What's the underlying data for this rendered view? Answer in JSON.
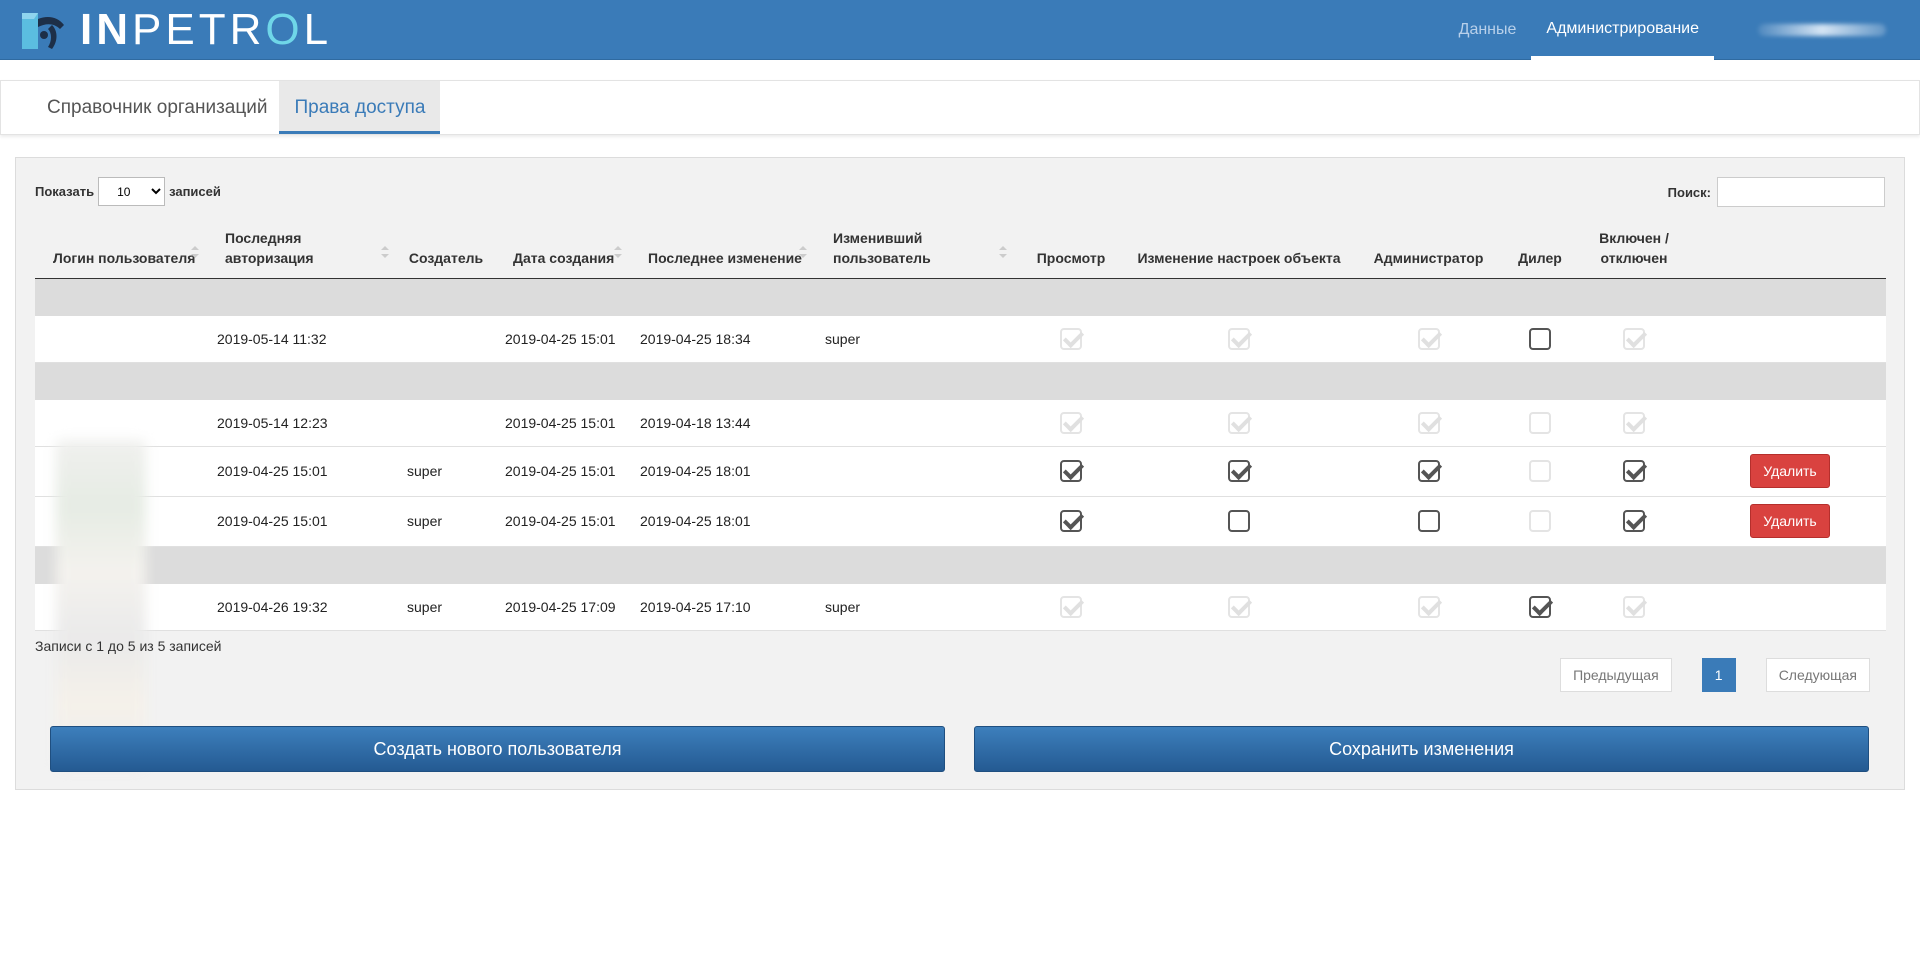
{
  "header": {
    "logo_text_bold": "IN",
    "logo_text_rest": "PETR",
    "logo_text_o": "O",
    "logo_text_end": "L",
    "nav": [
      {
        "label": "Данные"
      },
      {
        "label": "Администрирование"
      }
    ]
  },
  "tabs": [
    {
      "label": "Справочник организаций"
    },
    {
      "label": "Права доступа"
    }
  ],
  "controls": {
    "show_label": "Показать",
    "page_size": "10",
    "records_label": "записей",
    "search_label": "Поиск:",
    "search_value": ""
  },
  "columns": [
    "Логин пользователя",
    "Последняя авторизация",
    "Создатель",
    "Дата создания",
    "Последнее изменение",
    "Изменивший пользователь",
    "Просмотр",
    "Изменение настроек объекта",
    "Администратор",
    "Дилер",
    "Включен / отключен"
  ],
  "rows": [
    {
      "last_auth": "2019-05-14 11:32",
      "creator": "",
      "created": "2019-04-25 15:01",
      "modified": "2019-04-25 18:34",
      "modified_by": "super",
      "delete": ""
    },
    {
      "last_auth": "2019-05-14 12:23",
      "creator": "",
      "created": "2019-04-25 15:01",
      "modified": "2019-04-18 13:44",
      "modified_by": "",
      "delete": ""
    },
    {
      "last_auth": "2019-04-25 15:01",
      "creator": "super",
      "created": "2019-04-25 15:01",
      "modified": "2019-04-25 18:01",
      "modified_by": "",
      "delete": "Удалить"
    },
    {
      "last_auth": "2019-04-25 15:01",
      "creator": "super",
      "created": "2019-04-25 15:01",
      "modified": "2019-04-25 18:01",
      "modified_by": "",
      "delete": "Удалить"
    },
    {
      "last_auth": "2019-04-26 19:32",
      "creator": "super",
      "created": "2019-04-25 17:09",
      "modified": "2019-04-25 17:10",
      "modified_by": "super",
      "delete": ""
    }
  ],
  "footer": {
    "info": "Записи с 1 до 5 из 5 записей",
    "prev": "Предыдущая",
    "page": "1",
    "next": "Следующая"
  },
  "actions": {
    "create_user": "Создать нового пользователя",
    "save": "Сохранить изменения"
  },
  "colors": {
    "brand": "#3a7bb8",
    "danger": "#d9423f"
  }
}
